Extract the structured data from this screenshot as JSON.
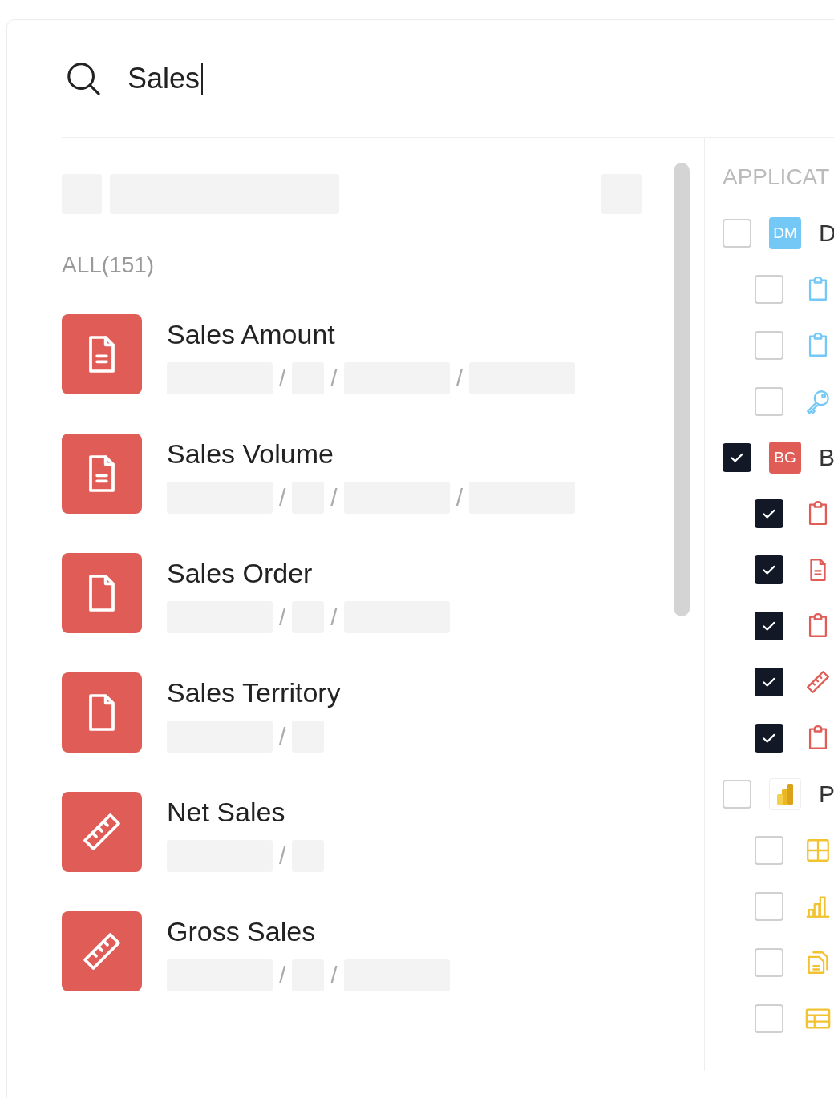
{
  "search": {
    "value": "Sales"
  },
  "results": {
    "heading": "ALL(151)",
    "items": [
      {
        "title": "Sales Amount",
        "kind": "document-lines",
        "path": [
          {
            "kind": "long"
          },
          {
            "kind": "separator",
            "text": "/"
          },
          {
            "kind": "short"
          },
          {
            "kind": "separator",
            "text": "/"
          },
          {
            "kind": "long"
          },
          {
            "kind": "separator",
            "text": "/"
          },
          {
            "kind": "long"
          }
        ]
      },
      {
        "title": "Sales Volume",
        "kind": "document-lines",
        "path": [
          {
            "kind": "long"
          },
          {
            "kind": "separator",
            "text": "/"
          },
          {
            "kind": "short"
          },
          {
            "kind": "separator",
            "text": "/"
          },
          {
            "kind": "long"
          },
          {
            "kind": "separator",
            "text": "/"
          },
          {
            "kind": "long"
          }
        ]
      },
      {
        "title": "Sales Order",
        "kind": "document",
        "path": [
          {
            "kind": "long"
          },
          {
            "kind": "separator",
            "text": "/"
          },
          {
            "kind": "short"
          },
          {
            "kind": "separator",
            "text": "/"
          },
          {
            "kind": "long"
          }
        ]
      },
      {
        "title": "Sales Territory",
        "kind": "document",
        "path": [
          {
            "kind": "long"
          },
          {
            "kind": "separator",
            "text": "/"
          },
          {
            "kind": "short"
          }
        ]
      },
      {
        "title": "Net Sales",
        "kind": "ruler",
        "path": [
          {
            "kind": "long"
          },
          {
            "kind": "separator",
            "text": "/"
          },
          {
            "kind": "short"
          }
        ]
      },
      {
        "title": "Gross Sales",
        "kind": "ruler",
        "path": [
          {
            "kind": "long"
          },
          {
            "kind": "separator",
            "text": "/"
          },
          {
            "kind": "short"
          },
          {
            "kind": "separator",
            "text": "/"
          },
          {
            "kind": "long"
          }
        ]
      }
    ]
  },
  "applications": {
    "heading": "APPLICAT",
    "groups": [
      {
        "badge": {
          "kind": "initials",
          "text": "DM"
        },
        "color": "#74c8f6",
        "label": "D",
        "checked": false,
        "children": [
          {
            "kind": "clipboard",
            "checked": false
          },
          {
            "kind": "clipboard",
            "checked": false
          },
          {
            "kind": "key",
            "checked": false
          }
        ]
      },
      {
        "badge": {
          "kind": "initials",
          "text": "BG"
        },
        "color": "#e05d57",
        "label": "B",
        "checked": true,
        "children": [
          {
            "kind": "clipboard",
            "checked": true
          },
          {
            "kind": "document-lines",
            "checked": true
          },
          {
            "kind": "clipboard",
            "checked": true
          },
          {
            "kind": "ruler",
            "checked": true
          },
          {
            "kind": "clipboard",
            "checked": true
          }
        ]
      },
      {
        "badge": {
          "kind": "logo"
        },
        "color": "#f2c230",
        "label": "P",
        "checked": false,
        "children": [
          {
            "kind": "grid",
            "checked": false
          },
          {
            "kind": "bar-chart",
            "checked": false
          },
          {
            "kind": "documents",
            "checked": false
          },
          {
            "kind": "table",
            "checked": false
          }
        ]
      }
    ]
  }
}
